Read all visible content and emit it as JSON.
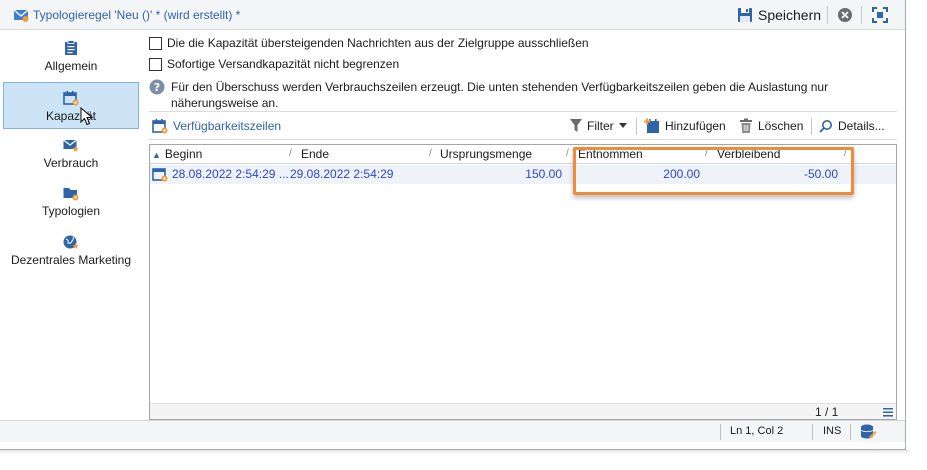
{
  "window": {
    "title": "Typologieregel 'Neu ()' * (wird erstellt) *",
    "title_icon": "envelope-rule-icon",
    "save_label": "Speichern"
  },
  "nav": {
    "items": [
      {
        "label": "Allgemein",
        "icon": "clipboard-icon"
      },
      {
        "label": "Kapazität",
        "icon": "calendar-gear-icon",
        "active": true
      },
      {
        "label": "Verbrauch",
        "icon": "envelope-star-icon"
      },
      {
        "label": "Typologien",
        "icon": "folder-gear-icon"
      },
      {
        "label": "Dezentrales Marketing",
        "icon": "globe-star-icon"
      }
    ]
  },
  "options": {
    "exclude_over_capacity": {
      "label": "Die die Kapazität übersteigenden Nachrichten aus der Zielgruppe ausschließen",
      "checked": false
    },
    "no_limit_immediate": {
      "label": "Sofortige Versandkapazität nicht begrenzen",
      "checked": false
    }
  },
  "info": {
    "text": "Für den Überschuss werden Verbrauchszeilen erzeugt. Die unten stehenden Verfügbarkeitszeilen geben die Auslastung nur näherungsweise an."
  },
  "toolbar": {
    "availability_label": "Verfügbarkeitszeilen",
    "filter_label": "Filter",
    "add_label": "Hinzufügen",
    "delete_label": "Löschen",
    "details_label": "Details..."
  },
  "grid": {
    "columns": [
      "Beginn",
      "Ende",
      "Ursprungsmenge",
      "Entnommen",
      "Verbleibend"
    ],
    "rows": [
      {
        "start": "28.08.2022 2:54:29 ...",
        "end": "29.08.2022 2:54:29",
        "initial": "150.00",
        "consumed": "200.00",
        "remaining": "-50.00"
      }
    ],
    "page": "1 / 1"
  },
  "status": {
    "position": "Ln 1, Col 2",
    "mode": "INS"
  },
  "colors": {
    "accent": "#2f65a8",
    "highlight": "#ee8c3a",
    "selection": "#cde4f7",
    "link_values": "#2d46c8"
  }
}
